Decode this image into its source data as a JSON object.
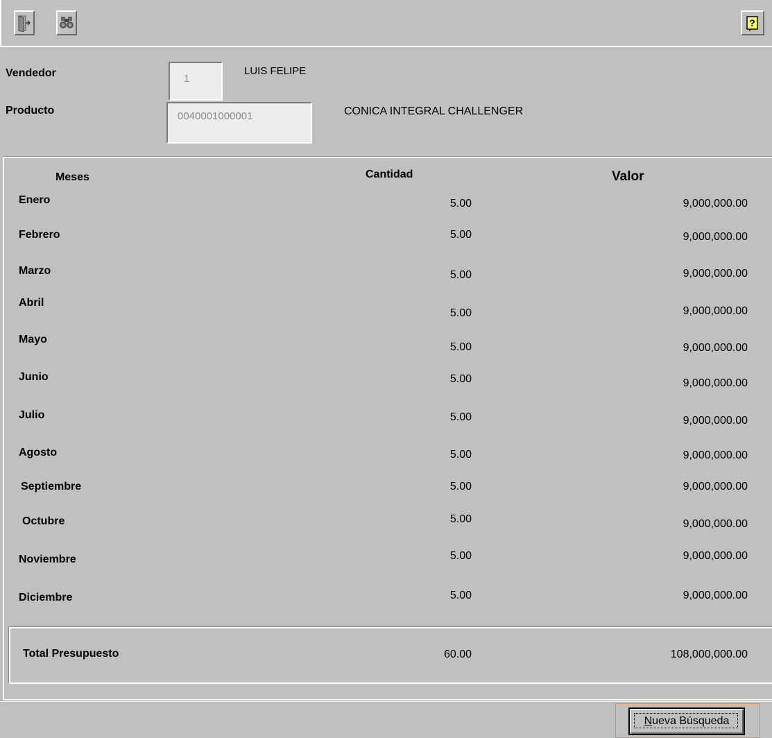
{
  "toolbar": {
    "exit_icon": "exit-door-icon",
    "search_icon": "binoculars-icon",
    "help_icon": "help-question-icon"
  },
  "form": {
    "vendedor_label": "Vendedor",
    "vendedor_code": "1",
    "vendedor_name": "LUIS FELIPE",
    "producto_label": "Producto",
    "producto_code": "0040001000001",
    "producto_name": "CONICA INTEGRAL CHALLENGER"
  },
  "table": {
    "headers": {
      "meses": "Meses",
      "cantidad": "Cantidad",
      "valor": "Valor"
    },
    "rows": [
      {
        "mes": "Enero",
        "cantidad": "5.00",
        "valor": "9,000,000.00"
      },
      {
        "mes": "Febrero",
        "cantidad": "5.00",
        "valor": "9,000,000.00"
      },
      {
        "mes": "Marzo",
        "cantidad": "5.00",
        "valor": "9,000,000.00"
      },
      {
        "mes": "Abril",
        "cantidad": "5.00",
        "valor": "9,000,000.00"
      },
      {
        "mes": "Mayo",
        "cantidad": "5.00",
        "valor": "9,000,000.00"
      },
      {
        "mes": "Junio",
        "cantidad": "5.00",
        "valor": "9,000,000.00"
      },
      {
        "mes": "Julio",
        "cantidad": "5.00",
        "valor": "9,000,000.00"
      },
      {
        "mes": "Agosto",
        "cantidad": "5.00",
        "valor": "9,000,000.00"
      },
      {
        "mes": "Septiembre",
        "cantidad": "5.00",
        "valor": "9,000,000.00"
      },
      {
        "mes": "Octubre",
        "cantidad": "5.00",
        "valor": "9,000,000.00"
      },
      {
        "mes": "Noviembre",
        "cantidad": "5.00",
        "valor": "9,000,000.00"
      },
      {
        "mes": "Diciembre",
        "cantidad": "5.00",
        "valor": "9,000,000.00"
      }
    ],
    "total": {
      "label": "Total Presupuesto",
      "cantidad": "60.00",
      "valor": "108,000,000.00"
    }
  },
  "actions": {
    "new_search_prefix": "N",
    "new_search_rest": "ueva Búsqueda"
  }
}
